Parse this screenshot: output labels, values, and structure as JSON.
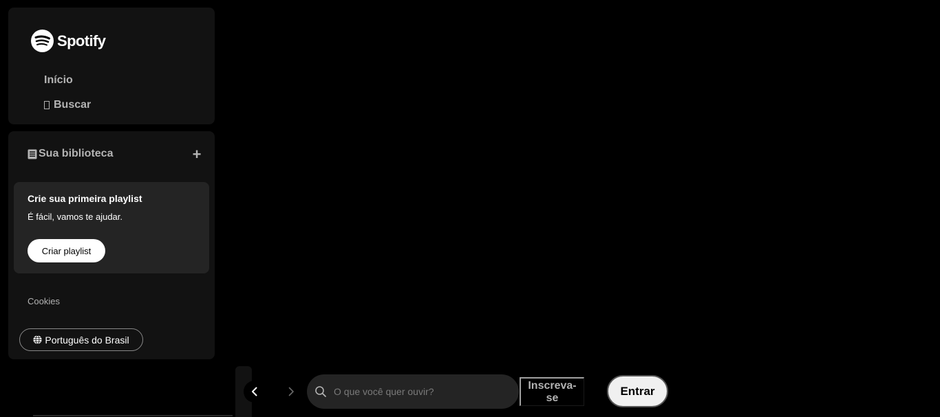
{
  "brand": {
    "name": "Spotify",
    "accent_color": "#ffffff",
    "logo_icon": "spotify-logo-icon"
  },
  "nav": {
    "home_label": "Início",
    "search_label": "Buscar",
    "search_icon": "missing-glyph-box"
  },
  "library": {
    "title": "Sua biblioteca",
    "library_icon": "library-icon",
    "add_label": "+",
    "card": {
      "title": "Crie sua primeira playlist",
      "subtitle": "É fácil, vamos te ajudar.",
      "button_label": "Criar playlist"
    },
    "cookies_label": "Cookies",
    "language_label": "Português do Brasil",
    "language_icon": "globe-icon"
  },
  "bottom_bar": {
    "back_icon": "chevron-left-icon",
    "forward_icon": "chevron-right-icon",
    "search_placeholder": "O que você quer ouvir?",
    "search_value": "",
    "signup_label": "Inscreva-se",
    "login_label": "Entrar"
  },
  "colors": {
    "background": "#000000",
    "panel": "#121212",
    "card": "#242424",
    "muted_text": "#b3b3b3"
  }
}
